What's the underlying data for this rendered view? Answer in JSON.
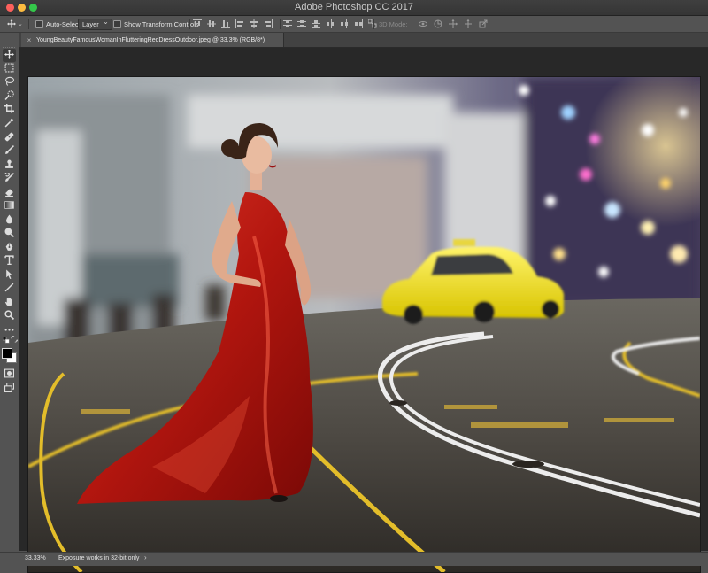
{
  "window": {
    "app_title": "Adobe Photoshop CC 2017"
  },
  "options_bar": {
    "auto_select_label": "Auto-Select:",
    "auto_select_value": "Layer",
    "show_transform_label": "Show Transform Controls",
    "mode_3d_label": "3D Mode:"
  },
  "document": {
    "tab_title": "YoungBeautyFamousWomanInFlutteringRedDressOutdoor.jpeg @ 33.3% (RGB/8*)",
    "close_glyph": "×"
  },
  "status_bar": {
    "zoom": "33.33%",
    "info": "Exposure works in 32-bit only",
    "arrow_glyph": "›"
  },
  "toolbox": {
    "tools": [
      "move-tool",
      "marquee-tool",
      "lasso-tool",
      "quick-selection-tool",
      "crop-tool",
      "eyedropper-tool",
      "healing-brush-tool",
      "brush-tool",
      "clone-stamp-tool",
      "history-brush-tool",
      "eraser-tool",
      "gradient-tool",
      "blur-tool",
      "dodge-tool",
      "pen-tool",
      "type-tool",
      "path-selection-tool",
      "line-tool",
      "hand-tool",
      "zoom-tool",
      "more-tools",
      "default-colors",
      "foreground-color",
      "background-color",
      "quick-mask",
      "screen-mode"
    ]
  },
  "colors": {
    "foreground": "#000000",
    "background": "#ffffff",
    "chrome": "#535353",
    "pasteboard": "#282828"
  }
}
